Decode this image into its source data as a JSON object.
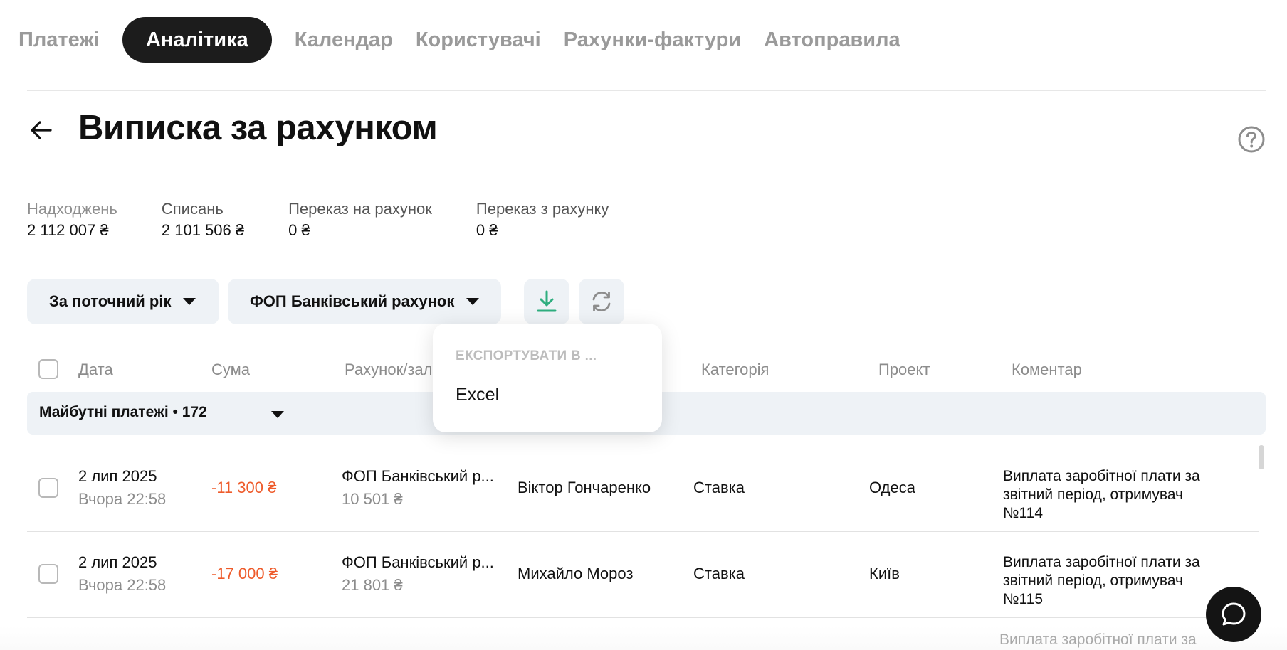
{
  "nav": {
    "tabs": [
      {
        "label": "Платежі",
        "active": false
      },
      {
        "label": "Аналітика",
        "active": true
      },
      {
        "label": "Календар",
        "active": false
      },
      {
        "label": "Користувачі",
        "active": false
      },
      {
        "label": "Рахунки-фактури",
        "active": false
      },
      {
        "label": "Автоправила",
        "active": false
      }
    ]
  },
  "header": {
    "title": "Виписка за рахунком",
    "back_icon": "arrow-left-icon",
    "help_icon": "question-circle-icon"
  },
  "stats": [
    {
      "label": "Надходжень",
      "value": "2 112 007 ₴"
    },
    {
      "label": "Списань",
      "value": "2 101 506 ₴"
    },
    {
      "label": "Переказ на рахунок",
      "value": "0 ₴"
    },
    {
      "label": "Переказ з рахунку",
      "value": "0 ₴"
    }
  ],
  "filters": {
    "period": "За поточний рік",
    "account": "ФОП Банківський рахунок",
    "download_icon": "download-icon",
    "refresh_icon": "refresh-icon"
  },
  "export_menu": {
    "header": "ЕКСПОРТУВАТИ В ...",
    "items": [
      "Excel"
    ]
  },
  "table": {
    "columns": [
      "Дата",
      "Сума",
      "Рахунок/зал",
      "Категорія",
      "Проект",
      "Коментар"
    ],
    "group": {
      "label": "Майбутні платежі • 172"
    },
    "rows": [
      {
        "date": "2 лип 2025",
        "time": "Вчора 22:58",
        "amount": "-11 300 ₴",
        "account": "ФОП Банківський р...",
        "balance": "10 501 ₴",
        "counterparty": "Віктор Гончаренко",
        "category": "Ставка",
        "project": "Одеса",
        "comment": "Виплата заробітної плати за звітний період, отримувач №114"
      },
      {
        "date": "2 лип 2025",
        "time": "Вчора 22:58",
        "amount": "-17 000 ₴",
        "account": "ФОП Банківський р...",
        "balance": "21 801 ₴",
        "counterparty": "Михайло Мороз",
        "category": "Ставка",
        "project": "Київ",
        "comment": "Виплата заробітної плати за звітний період, отримувач №115"
      }
    ],
    "partial_row_comment": "Виплата заробітної плати за"
  },
  "colors": {
    "accent_active_tab": "#1c1c1c",
    "negative_amount": "#ee5b2b",
    "download_icon": "#2fae7f",
    "filter_bg": "#eef2f6"
  },
  "chat_icon": "chat-bubble-icon"
}
